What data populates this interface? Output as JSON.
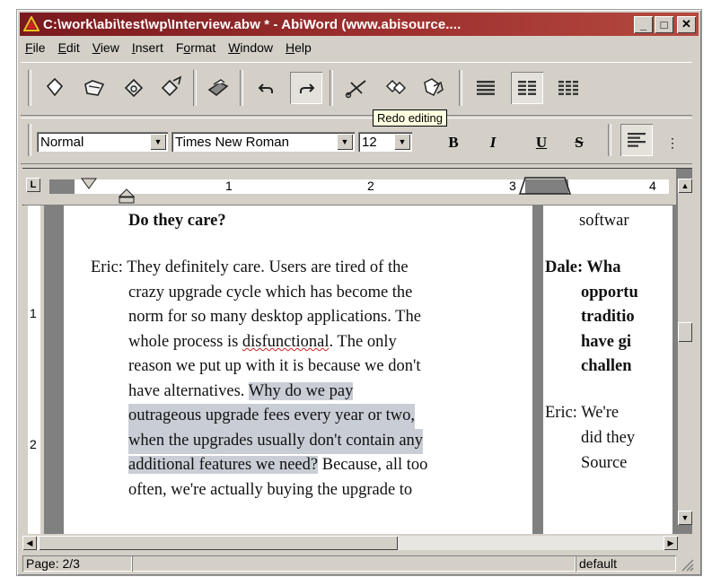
{
  "window": {
    "title": "C:\\work\\abi\\test\\wp\\Interview.abw * - AbiWord (www.abisource....",
    "controls": {
      "minimize": "_",
      "maximize": "□",
      "close": "✕"
    }
  },
  "menu": [
    {
      "pre": "",
      "u": "F",
      "post": "ile"
    },
    {
      "pre": "",
      "u": "E",
      "post": "dit"
    },
    {
      "pre": "",
      "u": "V",
      "post": "iew"
    },
    {
      "pre": "",
      "u": "I",
      "post": "nsert"
    },
    {
      "pre": "F",
      "u": "o",
      "post": "rmat"
    },
    {
      "pre": "",
      "u": "W",
      "post": "indow"
    },
    {
      "pre": "",
      "u": "H",
      "post": "elp"
    }
  ],
  "toolbar": {
    "tooltip": "Redo editing",
    "buttons": [
      "new-icon",
      "open-icon",
      "save-icon",
      "save-as-icon",
      "print-icon",
      "undo-icon",
      "redo-icon",
      "cut-icon",
      "copy-icon",
      "paste-icon",
      "align-justify-icon",
      "columns-two-icon",
      "columns-three-icon"
    ]
  },
  "format": {
    "style": "Normal",
    "font": "Times New Roman",
    "size": "12",
    "bold": "B",
    "italic": "I",
    "underline": "U",
    "strike": "S"
  },
  "ruler": {
    "h_numbers": [
      "1",
      "2",
      "3",
      "4"
    ],
    "v_numbers": [
      "1",
      "2"
    ],
    "corner": "L"
  },
  "document": {
    "heading": "Do they care?",
    "para_lines": [
      "Eric: They definitely care. Users are tired of the",
      "crazy upgrade cycle which has become the",
      "norm for so many desktop applications. The"
    ],
    "line4_pre": "whole process is ",
    "line4_misspelled": "disfunctional",
    "line4_post": ". The only",
    "line5": "reason we put up with it is because we don't",
    "line6_pre": "have alternatives. ",
    "line6_sel": "Why do we pay",
    "sel_lines": [
      "outrageous upgrade fees every year or two,",
      "when the upgrades usually don't contain any"
    ],
    "line9_sel": "additional features we need?",
    "line9_post": " Because, all too",
    "line10": "often, we're actually buying the upgrade to"
  },
  "page2": {
    "top": "softwar",
    "bold_lines": [
      "Dale: Wha",
      "opportu",
      "traditio",
      "have gi",
      "challen"
    ],
    "plain_lines": [
      "Eric: We're",
      "did they",
      "Source"
    ]
  },
  "status": {
    "page": "Page: 2/3",
    "mode": "default"
  }
}
